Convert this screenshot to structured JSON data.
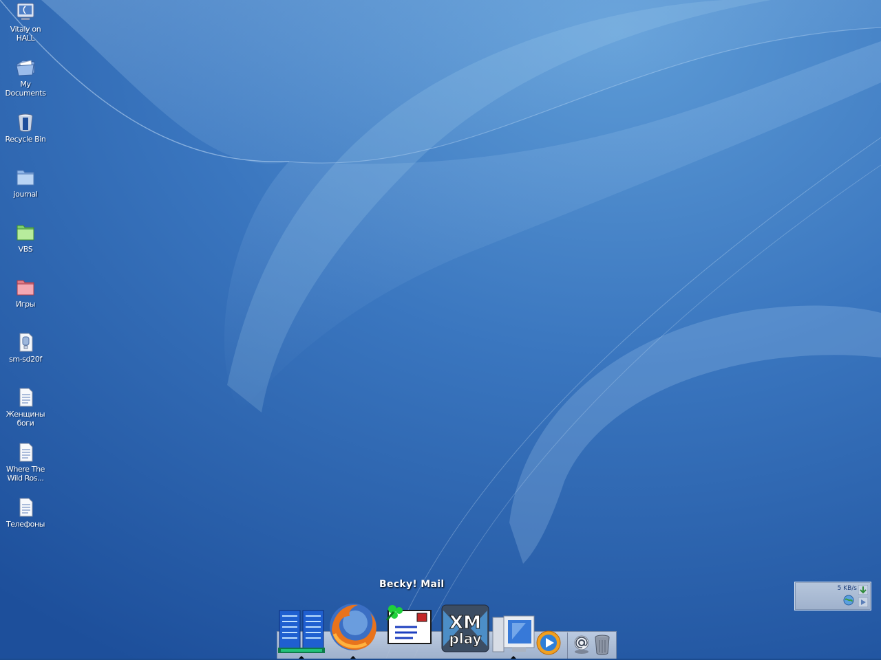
{
  "desktop": {
    "icons": [
      {
        "label": "Vitaly on HALL",
        "icon": "my-computer-icon"
      },
      {
        "label": "My Documents",
        "icon": "documents-folder-icon"
      },
      {
        "label": "Recycle Bin",
        "icon": "recycle-bin-icon"
      },
      {
        "label": "journal",
        "icon": "blue-folder-icon"
      },
      {
        "label": "VBS",
        "icon": "green-folder-icon"
      },
      {
        "label": "Игры",
        "icon": "red-folder-icon"
      },
      {
        "label": "sm-sd20f",
        "icon": "zip-archive-icon"
      },
      {
        "label": "Женщины\nбоги",
        "icon": "text-document-icon"
      },
      {
        "label": "Where The\nWild Ros...",
        "icon": "text-document-icon"
      },
      {
        "label": "Телефоны",
        "icon": "text-document-icon"
      }
    ]
  },
  "dock": {
    "tooltip": "Becky! Mail",
    "items": [
      {
        "icon": "server-icon",
        "running": true
      },
      {
        "icon": "firefox-icon",
        "running": true
      },
      {
        "icon": "becky-mail-icon",
        "running": false
      },
      {
        "icon": "xmplay-icon",
        "running": false,
        "text_line1": "XM",
        "text_line2": "play"
      },
      {
        "icon": "monitor-icon",
        "running": true
      },
      {
        "icon": "media-player-icon",
        "running": false
      },
      {
        "icon": "at-sign-icon",
        "running": false
      },
      {
        "icon": "trash-can-icon",
        "running": false
      }
    ]
  },
  "network_monitor": {
    "rate": "5 KB/s"
  },
  "colors": {
    "wallpaper_base": "#2a5ea8",
    "wallpaper_highlight": "#7fb3e3",
    "label_text": "#ffffff"
  }
}
